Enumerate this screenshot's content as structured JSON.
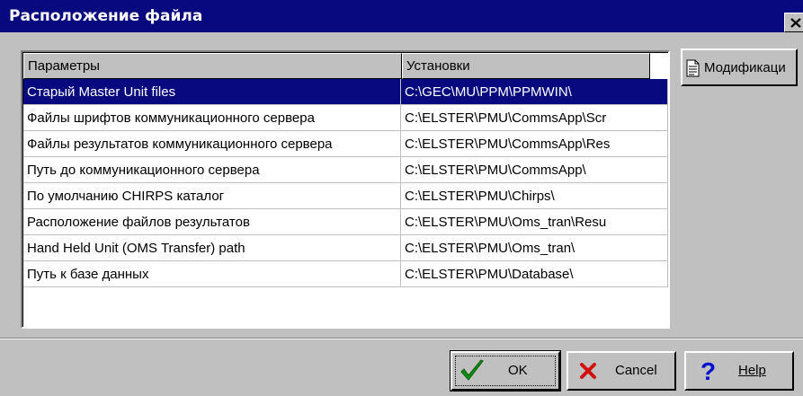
{
  "window": {
    "title": "Расположение файла",
    "close_glyph": "×"
  },
  "columns": [
    "Параметры",
    "Установки"
  ],
  "rows": [
    {
      "param": "Старый Master Unit files",
      "value": "C:\\GEC\\MU\\PPM\\PPMWIN\\",
      "selected": true
    },
    {
      "param": "Файлы шрифтов коммуникационного сервера",
      "value": "C:\\ELSTER\\PMU\\CommsApp\\Scr",
      "selected": false
    },
    {
      "param": "Файлы результатов коммуникационного сервера",
      "value": "C:\\ELSTER\\PMU\\CommsApp\\Res",
      "selected": false
    },
    {
      "param": "Путь до коммуникационного сервера",
      "value": "C:\\ELSTER\\PMU\\CommsApp\\",
      "selected": false
    },
    {
      "param": "По умолчанию CHIRPS каталог",
      "value": "C:\\ELSTER\\PMU\\Chirps\\",
      "selected": false
    },
    {
      "param": "Расположение файлов результатов",
      "value": "C:\\ELSTER\\PMU\\Oms_tran\\Resu",
      "selected": false
    },
    {
      "param": "Hand Held Unit (OMS Transfer) path",
      "value": "C:\\ELSTER\\PMU\\Oms_tran\\",
      "selected": false
    },
    {
      "param": "Путь к базе данных",
      "value": "C:\\ELSTER\\PMU\\Database\\",
      "selected": false
    }
  ],
  "buttons": {
    "modify": "Модификаци",
    "ok": "OK",
    "cancel": "Cancel",
    "help": "Help"
  },
  "icons": {
    "modify": "document-edit-icon",
    "ok": "checkmark-icon",
    "cancel": "red-x-icon",
    "help": "question-mark-icon"
  },
  "colors": {
    "titlebar": "#08087f",
    "selection": "#08087f",
    "face": "#c0c0c0",
    "ok_check": "#109010",
    "cancel_x": "#d01010",
    "help_q": "#0010d0"
  }
}
